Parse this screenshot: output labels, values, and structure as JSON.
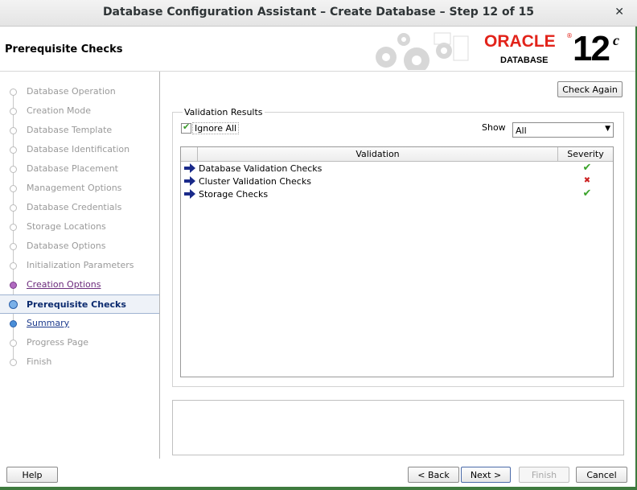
{
  "window": {
    "title": "Database Configuration Assistant – Create Database – Step 12 of 15",
    "close_label": "✕"
  },
  "header": {
    "page_title": "Prerequisite Checks",
    "logo_oracle": "ORACLE",
    "logo_database": "DATABASE",
    "logo_version": "12",
    "logo_version_suffix": "c"
  },
  "sidebar": {
    "steps": [
      {
        "label": "Database Operation",
        "state": "inactive"
      },
      {
        "label": "Creation Mode",
        "state": "inactive"
      },
      {
        "label": "Database Template",
        "state": "inactive"
      },
      {
        "label": "Database Identification",
        "state": "inactive"
      },
      {
        "label": "Database Placement",
        "state": "inactive"
      },
      {
        "label": "Management Options",
        "state": "inactive"
      },
      {
        "label": "Database Credentials",
        "state": "inactive"
      },
      {
        "label": "Storage Locations",
        "state": "inactive"
      },
      {
        "label": "Database Options",
        "state": "inactive"
      },
      {
        "label": "Initialization Parameters",
        "state": "inactive"
      },
      {
        "label": "Creation Options",
        "state": "visited"
      },
      {
        "label": "Prerequisite Checks",
        "state": "current"
      },
      {
        "label": "Summary",
        "state": "link"
      },
      {
        "label": "Progress Page",
        "state": "inactive"
      },
      {
        "label": "Finish",
        "state": "inactive"
      }
    ]
  },
  "main": {
    "check_again_label": "Check Again",
    "group_label": "Validation Results",
    "ignore_all_label": "Ignore All",
    "ignore_all_checked": true,
    "show_label": "Show",
    "show_value": "All",
    "table": {
      "columns": [
        "Validation",
        "Severity"
      ],
      "rows": [
        {
          "name": "Database Validation Checks",
          "severity": "✔",
          "status": "ok"
        },
        {
          "name": "Cluster Validation Checks",
          "severity": "✖",
          "status": "error"
        },
        {
          "name": "Storage Checks",
          "severity": "✔",
          "status": "ok"
        }
      ]
    }
  },
  "footer": {
    "help_label": "Help",
    "back_label": "< Back",
    "next_label": "Next >",
    "finish_label": "Finish",
    "cancel_label": "Cancel"
  },
  "colors": {
    "oracle_red": "#e2231a",
    "visited_step": "#6b2a7c",
    "link_step": "#1c3a8c",
    "ok_green": "#3aa32a",
    "error_red": "#cc2222"
  }
}
